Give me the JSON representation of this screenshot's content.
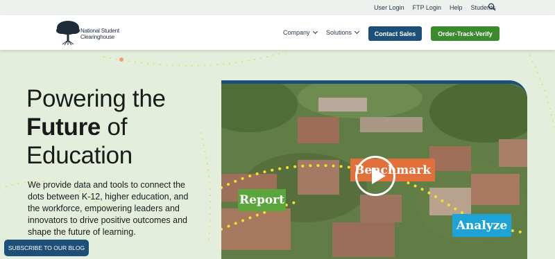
{
  "utility": {
    "links": [
      "User Login",
      "FTP Login",
      "Help",
      "Students"
    ],
    "search_icon": "search-icon"
  },
  "header": {
    "logo_line1": "National Student",
    "logo_line2": "Clearinghouse",
    "logo_icon": "tree-icon",
    "nav": [
      {
        "label": "Company",
        "icon": "chevron-down-icon"
      },
      {
        "label": "Solutions",
        "icon": "chevron-down-icon"
      }
    ],
    "contact_label": "Contact Sales",
    "order_label": "Order-Track-Verify"
  },
  "hero": {
    "title_line1": "Powering the",
    "title_bold": "Future",
    "title_of": "of",
    "title_line3": "Education",
    "description": "We provide data and tools to connect the dots between K-12, higher education, and the workforce, empowering leaders and innovators to drive positive outcomes and shape the future of learning."
  },
  "video": {
    "tags": [
      "Report",
      "Benchmark",
      "Analyze"
    ],
    "play_icon": "play-icon"
  },
  "subscribe_label": "SUBSCRIBE TO OUR BLOG",
  "colors": {
    "navy": "#1e4f78",
    "green": "#3c8a2e",
    "hero_bg": "#e3efdc",
    "report": "#5aa63c",
    "benchmark": "#e2703a",
    "analyze": "#1ea3d6",
    "dots": "#f0dc3a"
  }
}
